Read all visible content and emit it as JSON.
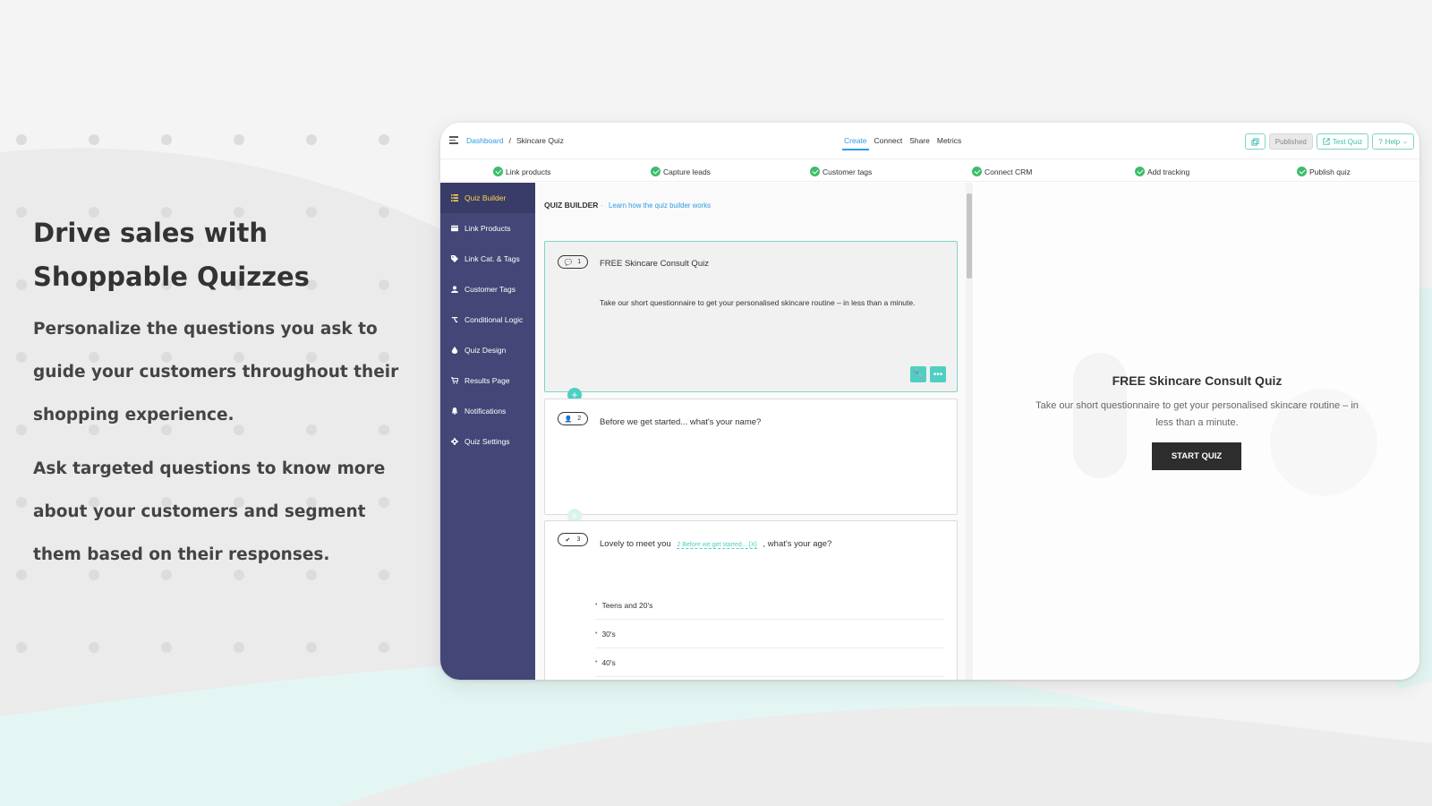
{
  "hero": {
    "title_line1": "Drive sales with",
    "title_line2": "Shoppable Quizzes",
    "paragraph1": "Personalize the questions you ask to guide your customers throughout their shopping experience.",
    "paragraph2": "Ask targeted questions to know more about your customers and segment them based on their responses."
  },
  "topbar": {
    "breadcrumb_root": "Dashboard",
    "breadcrumb_sep": "/",
    "breadcrumb_current": "Skincare Quiz",
    "tabs": [
      "Create",
      "Connect",
      "Share",
      "Metrics"
    ],
    "active_tab": "Create",
    "status_label": "Published",
    "test_quiz_label": "Test Quiz",
    "help_label": "Help"
  },
  "steps": [
    "Link products",
    "Capture leads",
    "Customer tags",
    "Connect CRM",
    "Add tracking",
    "Publish quiz"
  ],
  "sidebar": {
    "items": [
      {
        "label": "Quiz Builder",
        "icon": "list-icon"
      },
      {
        "label": "Link Products",
        "icon": "box-icon"
      },
      {
        "label": "Link Cat. & Tags",
        "icon": "tag-icon"
      },
      {
        "label": "Customer Tags",
        "icon": "user-icon"
      },
      {
        "label": "Conditional Logic",
        "icon": "branch-icon"
      },
      {
        "label": "Quiz Design",
        "icon": "droplet-icon"
      },
      {
        "label": "Results Page",
        "icon": "cart-icon"
      },
      {
        "label": "Notifications",
        "icon": "bell-icon"
      },
      {
        "label": "Quiz Settings",
        "icon": "gear-icon"
      }
    ],
    "active_index": 0
  },
  "builder": {
    "heading": "QUIZ BUILDER",
    "help_link": "Learn how the quiz builder works",
    "q1": {
      "number": "1",
      "title": "FREE Skincare Consult Quiz",
      "description": "Take our short questionnaire to get your personalised skincare routine – in less than a minute."
    },
    "q2": {
      "number": "2",
      "title": "Before we get started... what's your name?"
    },
    "q3": {
      "number": "3",
      "prefix": "Lovely to meet you",
      "pill": "2  Before we get started...  {X}",
      "suffix": ", what's your age?",
      "answers": [
        "Teens and 20's",
        "30's",
        "40's"
      ]
    }
  },
  "preview": {
    "title": "FREE Skincare Consult Quiz",
    "description": "Take our short questionnaire to get your personalised skincare routine – in less than a minute.",
    "button": "START QUIZ"
  },
  "colors": {
    "accent_teal": "#4fcfc1",
    "link_blue": "#2f9be2",
    "sidebar_bg": "#434676",
    "sidebar_active_text": "#ffd54a",
    "check_green": "#3dbd6c"
  }
}
